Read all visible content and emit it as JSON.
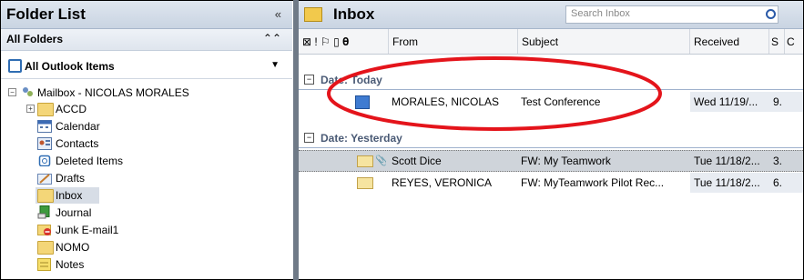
{
  "folder_list": {
    "title": "Folder List",
    "collapse_glyph": "«",
    "all_folders": "All Folders",
    "all_folders_glyph": "⌃⌃",
    "all_outlook_items": "All Outlook Items",
    "dropdown_glyph": "▼",
    "mailbox": "Mailbox - NICOLAS MORALES",
    "folders": [
      {
        "label": "ACCD",
        "icon": "folder-icon"
      },
      {
        "label": "Calendar",
        "icon": "calendar-icon"
      },
      {
        "label": "Contacts",
        "icon": "contacts-icon"
      },
      {
        "label": "Deleted Items",
        "icon": "deleted-items-icon"
      },
      {
        "label": "Drafts",
        "icon": "drafts-icon"
      },
      {
        "label": "Inbox",
        "icon": "inbox-icon"
      },
      {
        "label": "Journal",
        "icon": "journal-icon"
      },
      {
        "label": "Junk E-mail1",
        "icon": "junk-icon"
      },
      {
        "label": "NOMO",
        "icon": "folder-icon"
      },
      {
        "label": "Notes",
        "icon": "notes-icon"
      }
    ]
  },
  "inbox": {
    "title": "Inbox",
    "search_placeholder": "Search Inbox",
    "columns": {
      "icons": "⊠ ! ⚐ ▯ 𝛉",
      "from": "From",
      "subject": "Subject",
      "received": "Received",
      "size": "S",
      "cat": "C"
    },
    "groups": [
      {
        "label": "Date: Today",
        "rows": [
          {
            "from": "MORALES, NICOLAS",
            "subject": "Test Conference",
            "received": "Wed 11/19/...",
            "size": "9."
          }
        ]
      },
      {
        "label": "Date: Yesterday",
        "rows": [
          {
            "from": "Scott Dice",
            "subject": "FW: My Teamwork",
            "received": "Tue 11/18/2...",
            "size": "3."
          },
          {
            "from": "REYES, VERONICA",
            "subject": "FW: MyTeamwork Pilot Rec...",
            "received": "Tue 11/18/2...",
            "size": "6."
          }
        ]
      }
    ]
  },
  "colors": {
    "annotation": "#e4141b",
    "header_bg": "#c9d4e2",
    "divider": "#6f7a87"
  }
}
